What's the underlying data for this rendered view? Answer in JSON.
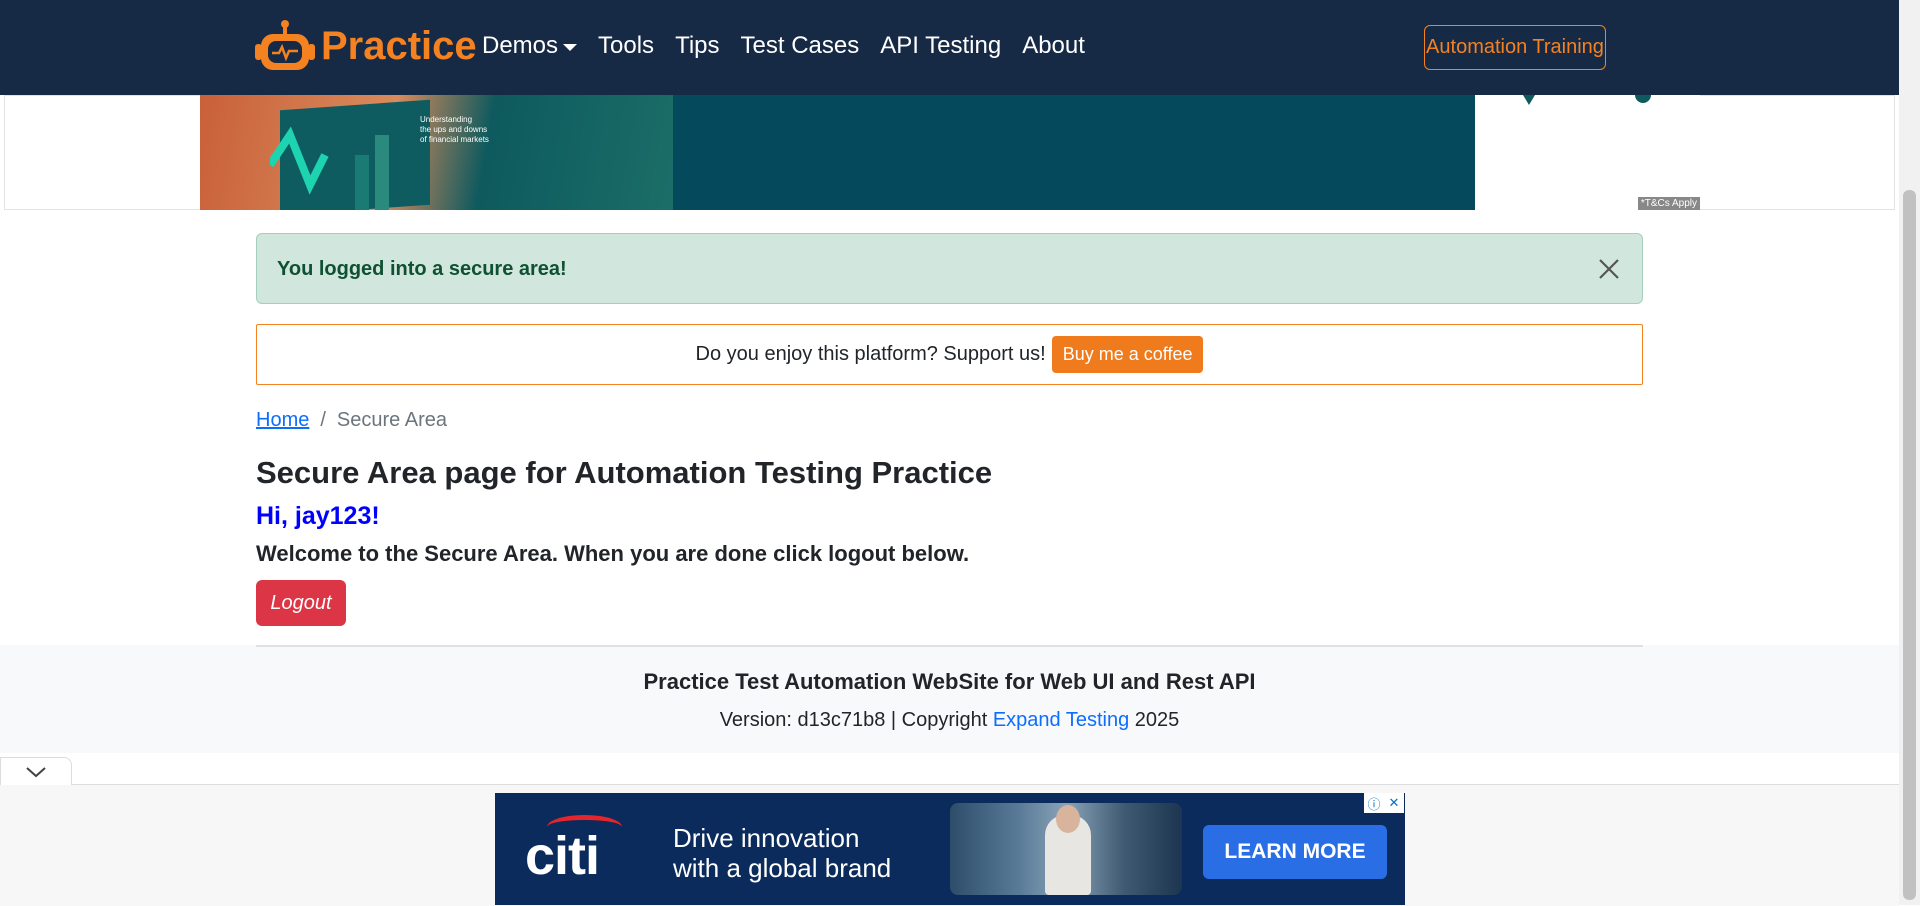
{
  "navbar": {
    "brand": "Practice",
    "links": [
      {
        "label": "Demos",
        "dropdown": true
      },
      {
        "label": "Tools"
      },
      {
        "label": "Tips"
      },
      {
        "label": "Test Cases"
      },
      {
        "label": "API Testing"
      },
      {
        "label": "About"
      }
    ],
    "cta": "Automation Training"
  },
  "top_ad": {
    "caption_lines": [
      "Understanding",
      "the ups and downs",
      "of financial markets"
    ],
    "tc": "*T&Cs Apply"
  },
  "alert": {
    "message": "You logged into a secure area!",
    "color": "#d1e7dd"
  },
  "support": {
    "text": "Do you enjoy this platform? Support us!",
    "button": "Buy me a coffee"
  },
  "breadcrumb": {
    "home": "Home",
    "separator": "/",
    "current": "Secure Area"
  },
  "main": {
    "title": "Secure Area page for Automation Testing Practice",
    "greeting": "Hi, jay123!",
    "welcome": "Welcome to the Secure Area. When you are done click logout below.",
    "logout": "Logout"
  },
  "footer": {
    "title": "Practice Test Automation WebSite for Web UI and Rest API",
    "version_prefix": "Version: d13c71b8 | Copyright ",
    "link": "Expand Testing",
    "year": " 2025"
  },
  "bottom_ad": {
    "brand": "citi",
    "headline_1": "Drive innovation",
    "headline_2": "with a global brand",
    "button": "LEARN MORE"
  },
  "colors": {
    "nav_bg": "#172a45",
    "accent": "#f58220",
    "danger": "#dc3545",
    "link": "#0d6efd"
  }
}
